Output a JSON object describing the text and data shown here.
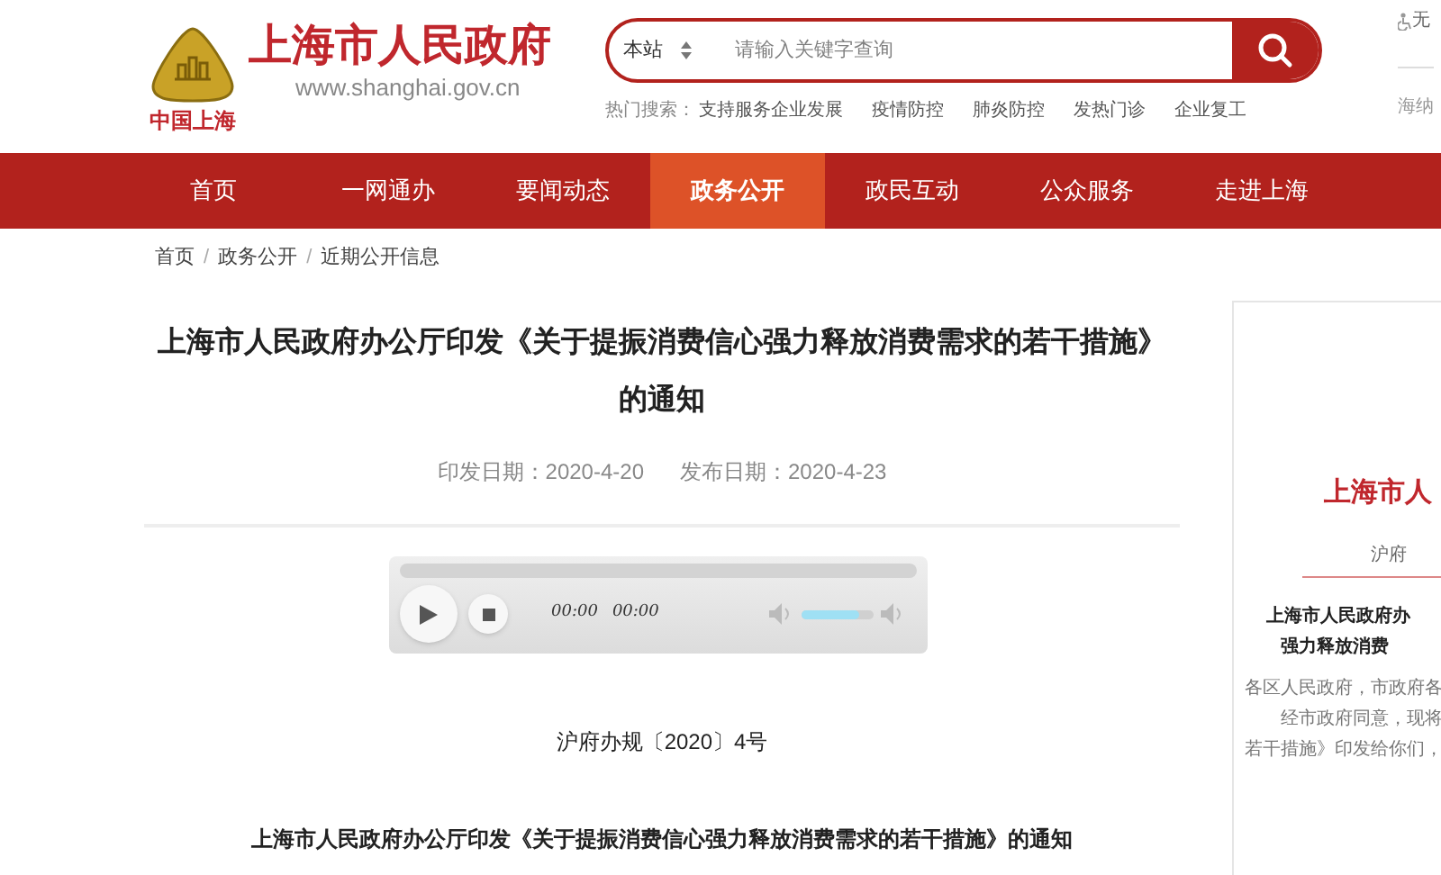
{
  "logo": {
    "title": "上海市人民政府",
    "url": "www.shanghai.gov.cn",
    "emblem_caption": "中国上海"
  },
  "search": {
    "scope": "本站",
    "placeholder": "请输入关键字查询"
  },
  "hot_search": {
    "label": "热门搜索：",
    "items": [
      "支持服务企业发展",
      "疫情防控",
      "肺炎防控",
      "发热门诊",
      "企业复工"
    ]
  },
  "top_right": {
    "accessibility": "无",
    "link": "海纳"
  },
  "nav": [
    {
      "label": "首页",
      "selected": false
    },
    {
      "label": "一网通办",
      "selected": false
    },
    {
      "label": "要闻动态",
      "selected": false
    },
    {
      "label": "政务公开",
      "selected": true
    },
    {
      "label": "政民互动",
      "selected": false
    },
    {
      "label": "公众服务",
      "selected": false
    },
    {
      "label": "走进上海",
      "selected": false
    }
  ],
  "breadcrumb": [
    {
      "label": "首页",
      "separator": "/"
    },
    {
      "label": "政务公开",
      "separator": "/"
    },
    {
      "label": "近期公开信息"
    }
  ],
  "article": {
    "title": "上海市人民政府办公厅印发《关于提振消费信心强力释放消费需求的若干措施》的通知",
    "issued": "印发日期：2020-4-20",
    "published": "发布日期：2020-4-23",
    "doc_number": "沪府办规〔2020〕4号",
    "subtitle": "上海市人民政府办公厅印发《关于提振消费信心强力释放消费需求的若干措施》的通知"
  },
  "player": {
    "current_time": "00:00",
    "total_time": "00:00",
    "volume": {
      "level": 0.8
    }
  },
  "document_preview": {
    "heading": "上海市人",
    "number": "沪府",
    "title_lines": [
      "上海市人民政府办",
      "强力释放消费"
    ],
    "body_lines": [
      "各区人民政府，市政府各",
      "经市政府同意，现将",
      "若干措施》印发给你们，"
    ]
  }
}
